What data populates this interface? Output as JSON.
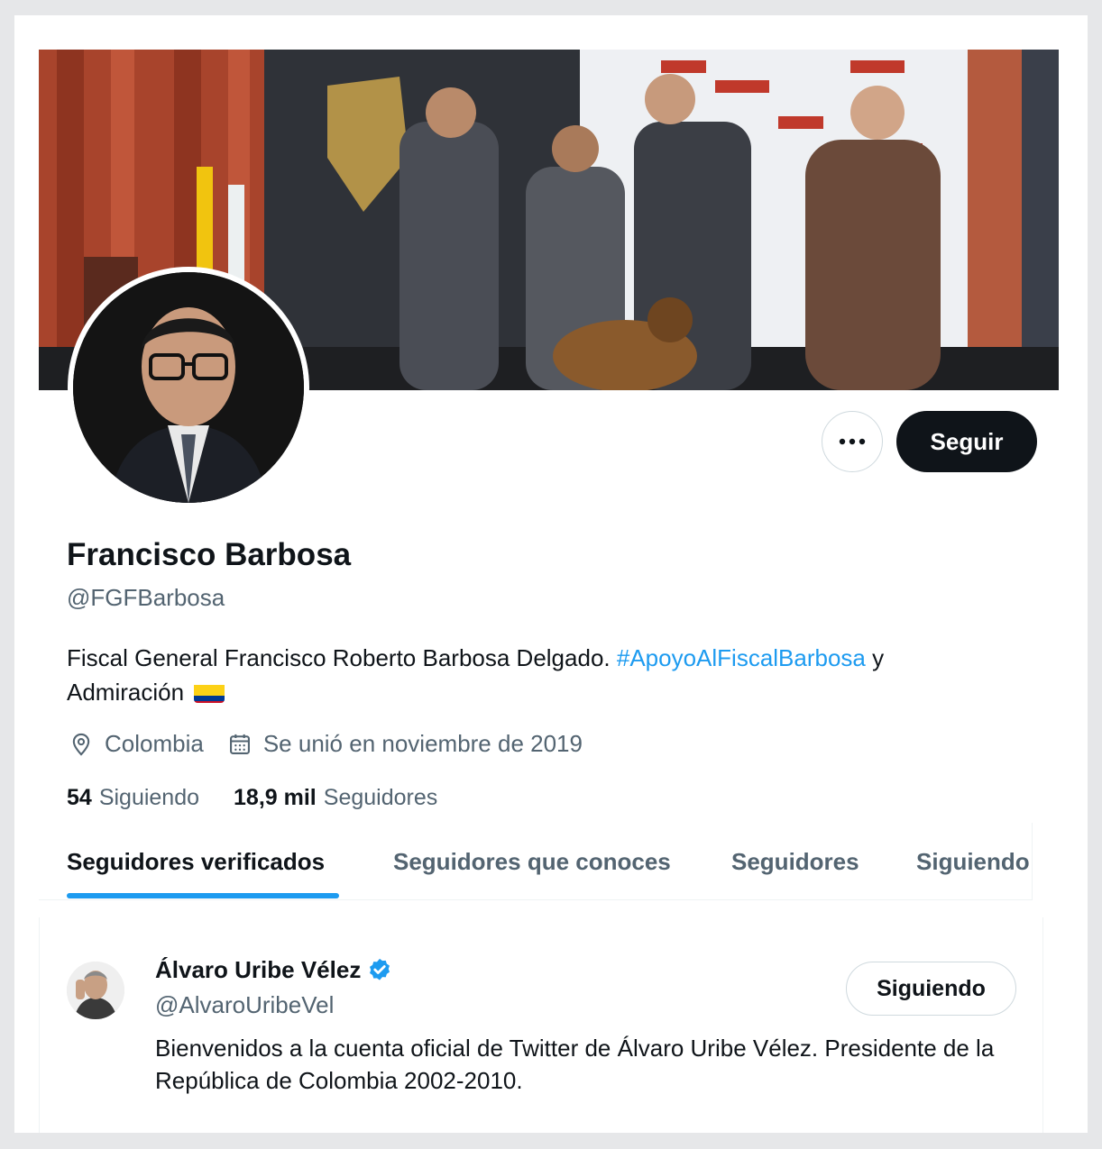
{
  "profile": {
    "name": "Francisco Barbosa",
    "handle": "@FGFBarbosa",
    "bio_text": "Fiscal General Francisco Roberto Barbosa Delgado.",
    "bio_hashtag": "#ApoyoAlFiscalBarbosa",
    "bio_tail": "y",
    "bio_line2": "Admiración",
    "location": "Colombia",
    "joined": "Se unió en noviembre de 2019",
    "following_count": "54",
    "following_label": "Siguiendo",
    "followers_count": "18,9 mil",
    "followers_label": "Seguidores",
    "banner_icon": "photo-banner",
    "avatar_icon": "profile-photo"
  },
  "actions": {
    "more_icon": "more-icon",
    "follow_label": "Seguir"
  },
  "tabs": [
    {
      "label": "Seguidores verificados",
      "active": true
    },
    {
      "label": "Seguidores que conoces",
      "active": false
    },
    {
      "label": "Seguidores",
      "active": false
    },
    {
      "label": "Siguiendo",
      "active": false
    }
  ],
  "users": [
    {
      "name": "Álvaro Uribe Vélez",
      "handle": "@AlvaroUribeVel",
      "bio": "Bienvenidos a la cuenta oficial de Twitter de Álvaro Uribe Vélez. Presidente de la República de Colombia 2002-2010.",
      "button_label": "Siguiendo",
      "verified": true
    }
  ],
  "colors": {
    "accent": "#1d9bf0",
    "text": "#0f1419",
    "secondary": "#536471"
  }
}
